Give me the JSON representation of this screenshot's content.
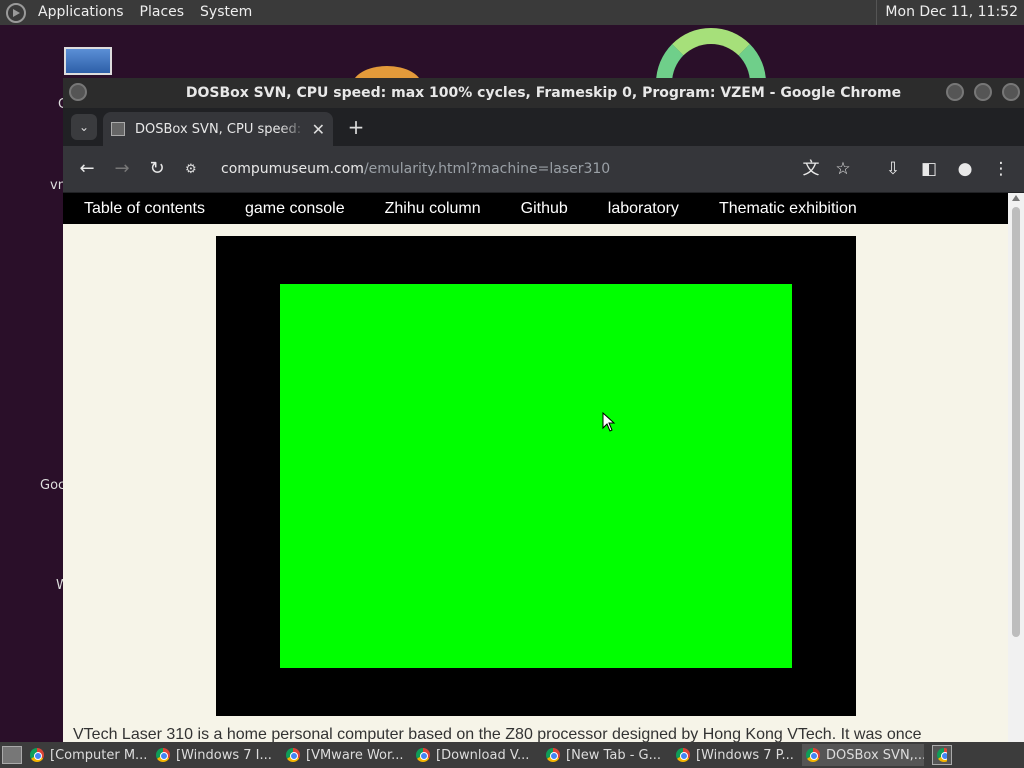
{
  "top_panel": {
    "menus": [
      "Applications",
      "Places",
      "System"
    ],
    "clock": "Mon Dec 11, 11:52"
  },
  "desktop": {
    "labels": [
      "C",
      "vn",
      "Goc",
      "W"
    ]
  },
  "window": {
    "title": "DOSBox SVN, CPU speed: max 100% cycles, Frameskip 0, Program: VZEM - Google Chrome",
    "tab_title": "DOSBox SVN, CPU speed: max 100% cycles, Frameskip 0, Program: VZEM",
    "url_host": "compumuseum.com",
    "url_path": "/emularity.html?machine=laser310"
  },
  "page": {
    "nav": [
      "Table of contents",
      "game console",
      "Zhihu column",
      "Github",
      "laboratory",
      "Thematic exhibition"
    ],
    "screen_color": "#00ff00",
    "caption": "VTech Laser 310 is a home personal computer based on the Z80 processor designed by Hong Kong VTech. It was once"
  },
  "taskbar": {
    "tasks": [
      "[Computer M...",
      "[Windows 7 I...",
      "[VMware Wor...",
      "[Download V...",
      "[New Tab - G...",
      "[Windows 7 P...",
      "DOSBox SVN,..."
    ]
  }
}
